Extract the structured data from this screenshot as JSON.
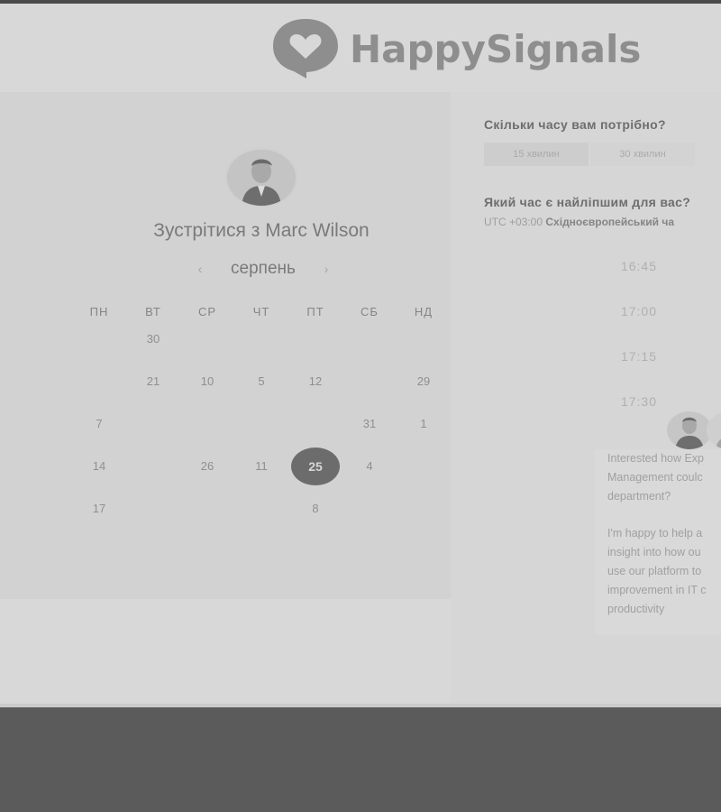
{
  "brand": {
    "name": "HappySignals"
  },
  "host": {
    "title": "Зустрітися з Marc Wilson"
  },
  "calendar": {
    "month": "серпень",
    "prev_icon": "chevron-left-icon",
    "next_icon": "chevron-right-icon",
    "weekdays": [
      "ПН",
      "ВТ",
      "СР",
      "ЧТ",
      "ПТ",
      "СБ",
      "НД"
    ],
    "weeks": [
      [
        {
          "d": "",
          "m": true
        },
        {
          "d": "30",
          "m": false
        },
        {
          "d": "",
          "m": true
        },
        {
          "d": "",
          "m": true
        },
        {
          "d": "",
          "m": true
        },
        {
          "d": "",
          "m": true
        },
        {
          "d": "",
          "m": true
        }
      ],
      [
        {
          "d": "",
          "m": true
        },
        {
          "d": "21",
          "m": false
        },
        {
          "d": "10",
          "m": false
        },
        {
          "d": "5",
          "m": false
        },
        {
          "d": "12",
          "m": false
        },
        {
          "d": "",
          "m": true
        },
        {
          "d": "29",
          "m": false
        }
      ],
      [
        {
          "d": "7",
          "m": false
        },
        {
          "d": "",
          "m": true
        },
        {
          "d": "",
          "m": true
        },
        {
          "d": "",
          "m": true
        },
        {
          "d": "",
          "m": true
        },
        {
          "d": "31",
          "m": false
        },
        {
          "d": "1",
          "m": false
        }
      ],
      [
        {
          "d": "14",
          "m": false
        },
        {
          "d": "",
          "m": true
        },
        {
          "d": "26",
          "m": false
        },
        {
          "d": "11",
          "m": false
        },
        {
          "d": "25",
          "m": false,
          "selected": true
        },
        {
          "d": "4",
          "m": false
        },
        {
          "d": "",
          "m": true
        }
      ],
      [
        {
          "d": "17",
          "m": false
        },
        {
          "d": "",
          "m": true
        },
        {
          "d": "",
          "m": true
        },
        {
          "d": "",
          "m": true
        },
        {
          "d": "8",
          "m": false
        },
        {
          "d": "",
          "m": true
        },
        {
          "d": "",
          "m": true
        }
      ]
    ],
    "selected_day": "25"
  },
  "booking": {
    "duration_question": "Скільки часу вам потрібно?",
    "durations": [
      "15 хвилин",
      "30 хвилин"
    ],
    "time_question": "Який час є найліпшим для вас?",
    "timezone_offset": "UTC +03:00",
    "timezone_name": "Східноєвропейський ча",
    "slots": [
      "16:45",
      "17:00",
      "17:15",
      "17:30"
    ]
  },
  "chat": {
    "message_1": "Interested how Exp\nManagement coulc\ndepartment?",
    "message_2": "I'm happy to help a\ninsight into how ou\nuse our platform to\nimprovement in IT c\nproductivity"
  },
  "colors": {
    "overlay_bg": "#d8d8d8",
    "selected_day_bg": "#6c6c6c",
    "footer_bg": "#5b5b5b"
  }
}
